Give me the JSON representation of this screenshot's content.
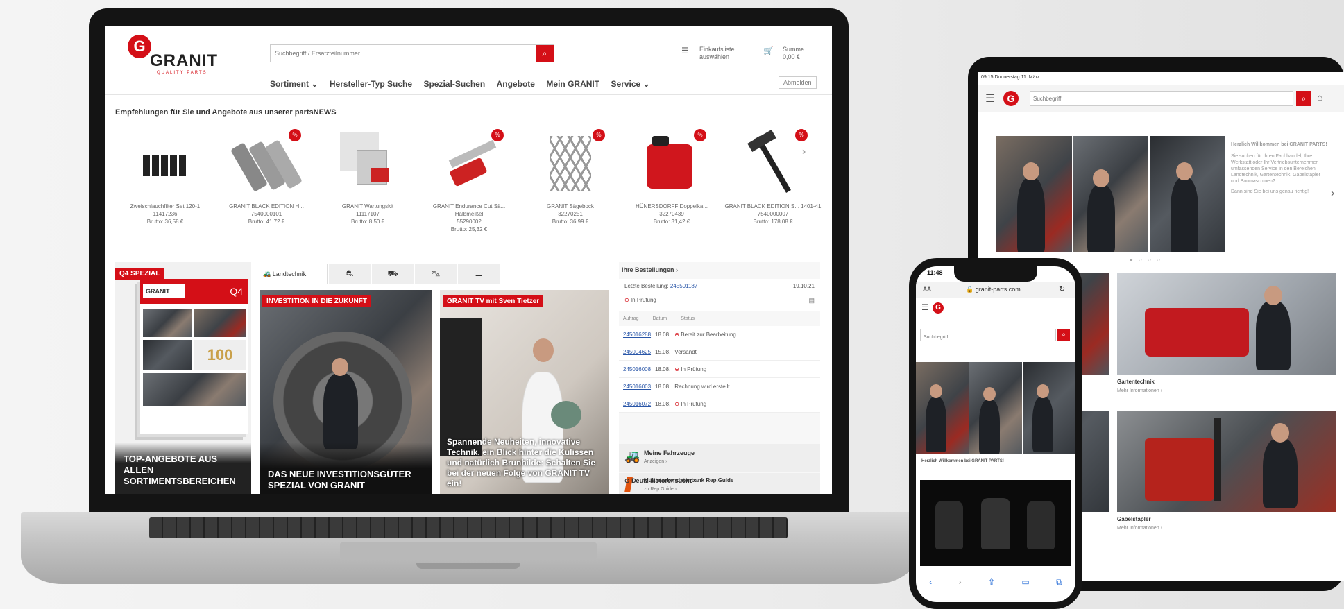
{
  "brand": {
    "logo_letter": "G",
    "name": "GRANIT",
    "tagline": "QUALITY PARTS"
  },
  "header": {
    "search_placeholder": "Suchbegriff / Ersatzteilnummer",
    "cart_label": "Einkaufsliste auswählen",
    "sum_label": "Summe",
    "sum_value": "0,00 €",
    "logout": "Abmelden"
  },
  "nav": [
    "Sortiment ⌄",
    "Hersteller-Typ Suche",
    "Spezial-Suchen",
    "Angebote",
    "Mein GRANIT",
    "Service ⌄"
  ],
  "recommend_heading": "Empfehlungen für Sie und Angebote aus unserer partsNEWS",
  "products": [
    {
      "name": "Zweischlauchfilter Set 120-1",
      "sku": "11417236",
      "price": "Brutto: 36,58 €"
    },
    {
      "name": "GRANIT BLACK EDITION H...",
      "sku": "7540000101",
      "price": "Brutto: 41,72 €"
    },
    {
      "name": "GRANIT Wartungskit",
      "sku": "11117107",
      "price": "Brutto: 8,50 €"
    },
    {
      "name": "GRANIT Endurance Cut Sä... Halbmeißel",
      "sku": "55290002",
      "price": "Brutto: 25,32 €"
    },
    {
      "name": "GRANIT Sägebock",
      "sku": "32270251",
      "price": "Brutto: 36,99 €"
    },
    {
      "name": "HÜNERSDORFF Doppelka...",
      "sku": "32270439",
      "price": "Brutto: 31,42 €"
    },
    {
      "name": "GRANIT BLACK EDITION S... 1401-41",
      "sku": "7540000007",
      "price": "Brutto: 178,08 €"
    }
  ],
  "promo": {
    "q4_tag": "Q4 SPEZIAL",
    "q4_label": "Q4",
    "q4_number": "100",
    "q4_title": "TOP-ANGEBOTE AUS ALLEN SORTIMENTSBEREICHEN",
    "invest_tag": "INVESTITION IN DIE ZUKUNFT",
    "invest_title": "DAS NEUE INVESTITIONSGÜTER SPEZIAL VON GRANIT",
    "tv_tag": "GRANIT TV mit Sven Tietzer",
    "tv_text": "Spannende Neuheiten, innovative Technik, ein Blick hinter die Kulissen und natürlich Brunhilde: Schalten Sie bei der neuen Folge von GRANIT TV ein!",
    "tab_label": "Landtechnik"
  },
  "orders": {
    "heading": "Ihre Bestellungen ›",
    "last_label": "Letzte Bestellung:",
    "last_number": "245501187",
    "last_date": "19.10.21",
    "last_status": "In Prüfung",
    "columns": [
      "Auftrag",
      "Datum",
      "Status"
    ],
    "rows": [
      {
        "num": "245016288",
        "date": "18.08.",
        "status": "Bereit zur Bearbeitung"
      },
      {
        "num": "245004625",
        "date": "15.08.",
        "status": "Versandt"
      },
      {
        "num": "245016008",
        "date": "18.08.",
        "status": "In Prüfung"
      },
      {
        "num": "245016003",
        "date": "18.08.",
        "status": "Rechnung wird erstellt"
      },
      {
        "num": "245016072",
        "date": "18.08.",
        "status": "In Prüfung"
      }
    ],
    "vehicles_title": "Meine Fahrzeuge",
    "vehicles_link": "Anzeigen ›",
    "guide_title": "Multimarkendatenbank Rep.Guide",
    "guide_link": "zu Rep.Guide ›",
    "deutz_title": "Deutz Motorensuche"
  },
  "tablet": {
    "status": "09:15  Donnerstag 11. März",
    "search_placeholder": "Suchbegriff",
    "welcome_title": "Herzlich Willkommen bei GRANIT PARTS!",
    "welcome_text": "Sie suchen für Ihren Fachhandel, Ihre Werkstatt oder Ihr Vertriebsunternehmen umfassenden Service in den Bereichen Landtechnik, Gartentechnik, Gabelstapler und Baumaschinen?",
    "welcome_link": "Dann sind Sie bei uns genau richtig!",
    "cat1": "Gartentechnik",
    "cat1_link": "Mehr Informationen ›",
    "cat2": "Gabelstapler",
    "cat2_link": "Mehr Informationen ›"
  },
  "phone": {
    "time": "11:48",
    "aa": "AA",
    "url": "🔒 granit-parts.com",
    "search_placeholder": "Suchbegriff",
    "welcome": "Herzlich Willkommen bei GRANIT PARTS!"
  }
}
